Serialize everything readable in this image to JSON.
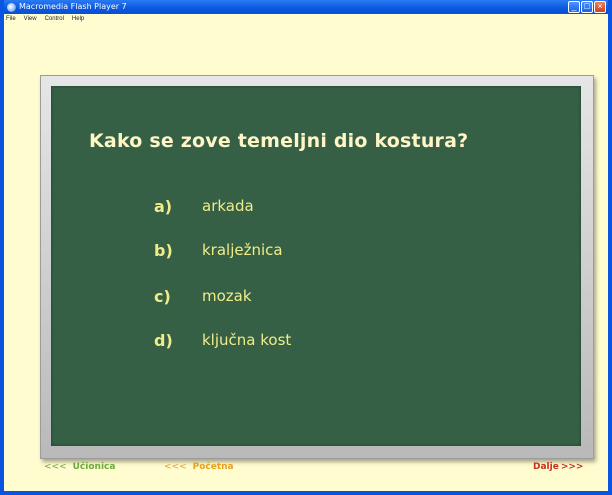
{
  "window": {
    "title": "Macromedia Flash Player 7"
  },
  "menu": [
    "File",
    "View",
    "Control",
    "Help"
  ],
  "quiz": {
    "question": "Kako se zove temeljni dio kostura?",
    "answers": [
      {
        "letter": "a)",
        "text": "arkada"
      },
      {
        "letter": "b)",
        "text": "kralježnica"
      },
      {
        "letter": "c)",
        "text": "mozak"
      },
      {
        "letter": "d)",
        "text": "ključna kost"
      }
    ]
  },
  "footer": {
    "ucionica": {
      "arrows": "<<<",
      "label": "Učionica"
    },
    "pocetna": {
      "arrows": "<<<",
      "label": "Početna"
    },
    "dalje": {
      "label": "Dalje",
      "arrows": ">>>"
    }
  },
  "colors": {
    "board": "#356045",
    "question_text": "#fff6c8",
    "answer_text": "#f0ec8a",
    "link_green": "#6aaa3a",
    "link_orange": "#e8a020",
    "link_red": "#c8301c"
  }
}
